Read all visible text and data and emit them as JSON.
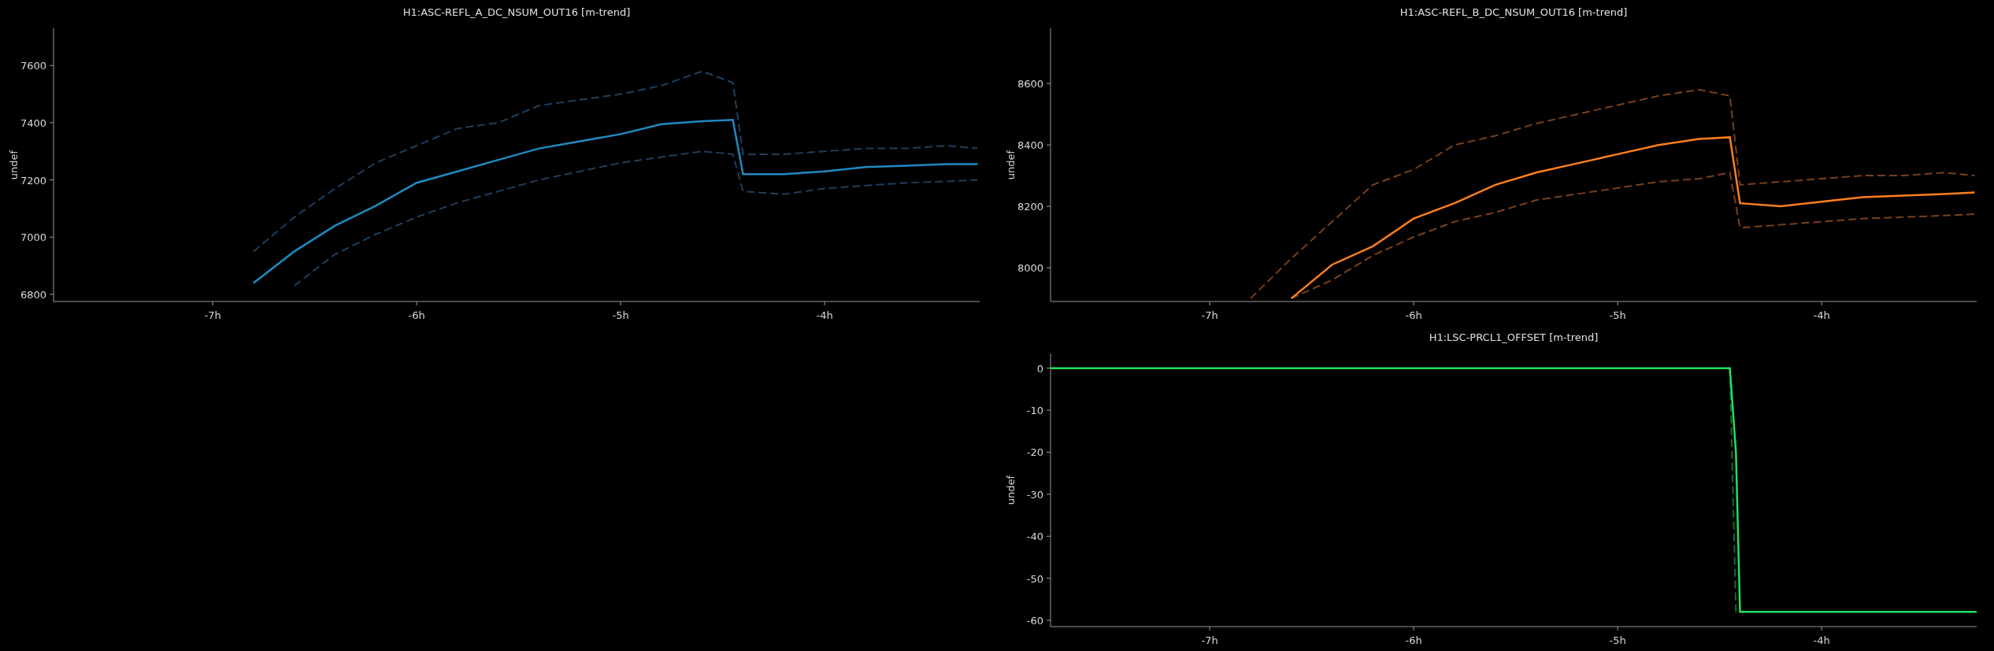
{
  "columns": [
    {
      "plots": [
        {
          "chart_data": {
            "type": "line",
            "title": "H1:ASC-REFL_A_DC_NSUM_OUT16 [m-trend]",
            "ylabel": "undef",
            "x": [
              -6.8,
              -6.6,
              -6.4,
              -6.2,
              -6.0,
              -5.8,
              -5.6,
              -5.4,
              -5.2,
              -5.0,
              -4.8,
              -4.6,
              -4.45,
              -4.4,
              -4.2,
              -4.0,
              -3.8,
              -3.6,
              -3.4,
              -3.25
            ],
            "series": [
              {
                "line_style": "dashed",
                "color": "#1e3f5e",
                "values": [
                  6950,
                  7070,
                  7170,
                  7260,
                  7320,
                  7380,
                  7400,
                  7460,
                  7480,
                  7500,
                  7530,
                  7580,
                  7540,
                  7290,
                  7290,
                  7300,
                  7310,
                  7310,
                  7320,
                  7310
                ]
              },
              {
                "line_style": "dashed",
                "color": "#1e3f5e",
                "values": [
                  null,
                  6830,
                  6940,
                  7010,
                  7070,
                  7120,
                  7160,
                  7200,
                  7230,
                  7260,
                  7280,
                  7300,
                  7290,
                  7160,
                  7150,
                  7170,
                  7180,
                  7190,
                  7195,
                  7200
                ]
              },
              {
                "line_style": "solid",
                "color": "#1f8ac0",
                "values": [
                  6840,
                  6950,
                  7040,
                  7110,
                  7190,
                  7230,
                  7270,
                  7310,
                  7335,
                  7360,
                  7395,
                  7405,
                  7410,
                  7220,
                  7220,
                  7230,
                  7245,
                  7250,
                  7255,
                  7255
                ]
              }
            ],
            "xlim": [
              -7.78,
              -3.24
            ],
            "ylim": [
              6775,
              7730
            ],
            "xticks": [
              {
                "value": -7,
                "label": "-7h"
              },
              {
                "value": -6,
                "label": "-6h"
              },
              {
                "value": -5,
                "label": "-5h"
              },
              {
                "value": -4,
                "label": "-4h"
              }
            ],
            "yticks": [
              6800,
              7000,
              7200,
              7400,
              7600
            ]
          }
        }
      ]
    },
    {
      "plots": [
        {
          "chart_data": {
            "type": "line",
            "title": "H1:ASC-REFL_B_DC_NSUM_OUT16 [m-trend]",
            "ylabel": "undef",
            "x": [
              -6.8,
              -6.6,
              -6.4,
              -6.2,
              -6.0,
              -5.8,
              -5.6,
              -5.4,
              -5.2,
              -5.0,
              -4.8,
              -4.6,
              -4.45,
              -4.4,
              -4.2,
              -4.0,
              -3.8,
              -3.6,
              -3.4,
              -3.25
            ],
            "series": [
              {
                "line_style": "dashed",
                "color": "#7a3f1a",
                "values": [
                  7900,
                  8030,
                  8150,
                  8270,
                  8320,
                  8400,
                  8430,
                  8470,
                  8500,
                  8530,
                  8560,
                  8580,
                  8560,
                  8270,
                  8280,
                  8290,
                  8300,
                  8300,
                  8310,
                  8300
                ]
              },
              {
                "line_style": "dashed",
                "color": "#7a3f1a",
                "values": [
                  null,
                  7900,
                  7960,
                  8040,
                  8100,
                  8150,
                  8180,
                  8220,
                  8240,
                  8260,
                  8280,
                  8290,
                  8310,
                  8130,
                  8140,
                  8150,
                  8160,
                  8165,
                  8170,
                  8175
                ]
              },
              {
                "line_style": "solid",
                "color": "#ff7f1e",
                "values": [
                  null,
                  7900,
                  8010,
                  8070,
                  8160,
                  8210,
                  8270,
                  8310,
                  8340,
                  8370,
                  8400,
                  8420,
                  8425,
                  8210,
                  8200,
                  8215,
                  8230,
                  8235,
                  8240,
                  8245
                ]
              }
            ],
            "xlim": [
              -7.78,
              -3.24
            ],
            "ylim": [
              7890,
              8780
            ],
            "xticks": [
              {
                "value": -7,
                "label": "-7h"
              },
              {
                "value": -6,
                "label": "-6h"
              },
              {
                "value": -5,
                "label": "-5h"
              },
              {
                "value": -4,
                "label": "-4h"
              }
            ],
            "yticks": [
              8000,
              8200,
              8400,
              8600
            ]
          }
        },
        {
          "chart_data": {
            "type": "line",
            "title": "H1:LSC-PRCL1_OFFSET [m-trend]",
            "ylabel": "undef",
            "x": [
              -7.78,
              -4.45,
              -4.42,
              -4.4,
              -3.24
            ],
            "series": [
              {
                "line_style": "dashed",
                "color": "#156a30",
                "values": [
                  null,
                  0,
                  -58,
                  -58,
                  null
                ]
              },
              {
                "line_style": "solid",
                "color": "#20e060",
                "values": [
                  0,
                  0,
                  -20,
                  -58,
                  -58
                ]
              }
            ],
            "xlim": [
              -7.78,
              -3.24
            ],
            "ylim": [
              -61.5,
              3.5
            ],
            "xticks": [
              {
                "value": -7,
                "label": "-7h"
              },
              {
                "value": -6,
                "label": "-6h"
              },
              {
                "value": -5,
                "label": "-5h"
              },
              {
                "value": -4,
                "label": "-4h"
              }
            ],
            "yticks": [
              0,
              -10,
              -20,
              -30,
              -40,
              -50,
              -60
            ]
          }
        }
      ]
    }
  ]
}
